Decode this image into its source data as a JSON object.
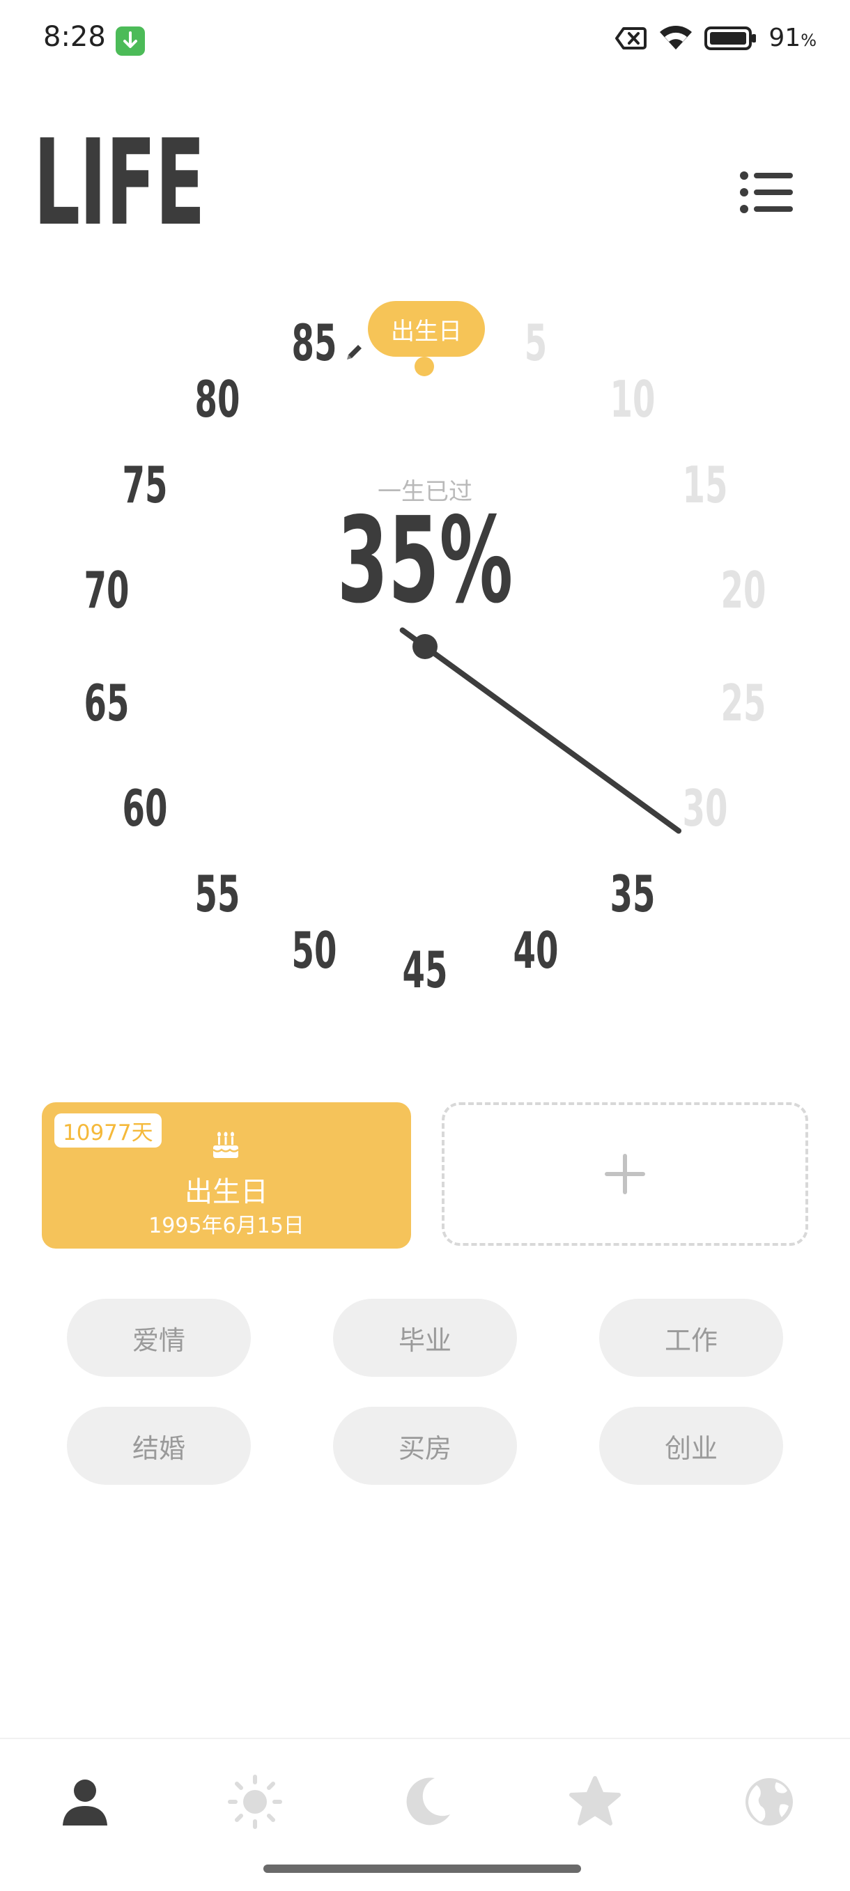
{
  "status_bar": {
    "time": "8:28",
    "battery_value": "91",
    "battery_unit": "%"
  },
  "header": {
    "title": "LIFE"
  },
  "dial": {
    "labels": [
      "5",
      "10",
      "15",
      "20",
      "25",
      "30",
      "35",
      "40",
      "45",
      "50",
      "55",
      "60",
      "65",
      "70",
      "75",
      "80",
      "85"
    ],
    "progress_percent": 35,
    "bubble": "出生日",
    "center_label": "一生已过",
    "center_value": "35%"
  },
  "event_card": {
    "days": "10977天",
    "title": "出生日",
    "date": "1995年6月15日"
  },
  "tags": [
    "爱情",
    "毕业",
    "工作",
    "结婚",
    "买房",
    "创业"
  ],
  "nav": {
    "items": [
      "person-icon",
      "sun-icon",
      "moon-icon",
      "star-icon",
      "globe-icon"
    ],
    "active_color": "#3d3d3d",
    "inactive_color": "#dcdcdc"
  },
  "colors": {
    "accent": "#f5c35a",
    "text_dark": "#3d3d3d",
    "text_faded": "#e3e3e3"
  }
}
